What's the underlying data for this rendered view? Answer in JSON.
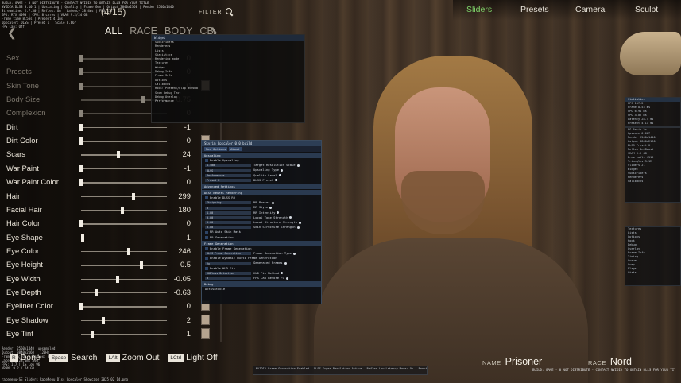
{
  "debug": {
    "top_lines": [
      "BUILD: GAME - 0 NOT DISTRIBUTE - CONTACT NVIDIA TO OBTAIN DLLS FOR YOUR TITLE",
      "NVIDIA DLSS 3.10.1 | Upscaling | Quality | Frame Gen | Output 3840x2160 | Render 2560x1440",
      "Streamline: 2.7.30 | Reflex: On | Latency 28.4ms | FPS 117",
      "GPU: RTX 4090 | CPU: 8 cores | VRAM 9.2/24 GB",
      "",
      "Frame time 8.5ms | Present 4.1ms",
      "Upscaler: DLSS | Preset K | Scale 0.667",
      "FPS Cap: Off"
    ],
    "bottom_lines": [
      "Render: 2560x1440 (upsampled)",
      "Output: 3840x2160 | 120Hz",
      "Frame Gen: On | Reflex: Boost",
      "Latency: 28.4ms avg",
      "FPS: 117 | 1% low 96",
      "VRAM: 9.2 / 24 GB"
    ],
    "filename": "racemenu-SE_Sliders_RaceMenu_Dlss_Upscaler_Showcase_2025_02_14.png",
    "right_footer": "BUILD: GAME - 0 NOT DISTRIBUTE - CONTACT NVIDIA TO OBTAIN DLLS FOR YOUR TITLE"
  },
  "header": {
    "count": "(4/15)",
    "filter_label": "FILTER",
    "filter_icon": "search-icon"
  },
  "categories": {
    "prev_icon": "chevron-left-icon",
    "next_icon": "chevron-right-icon",
    "items": [
      "ALL",
      "RACE",
      "BODY",
      "CB"
    ],
    "active": "ALL"
  },
  "sliders": [
    {
      "label": "Sex",
      "value": "0",
      "pos": 0.0,
      "swatch": false,
      "dim": true
    },
    {
      "label": "Presets",
      "value": "0",
      "pos": 0.0,
      "swatch": false,
      "dim": true
    },
    {
      "label": "Skin Tone",
      "value": "0",
      "pos": 0.0,
      "swatch": true,
      "dim": true
    },
    {
      "label": "Body Size",
      "value": "0.75",
      "pos": 0.75,
      "swatch": false,
      "dim": true
    },
    {
      "label": "Complexion",
      "value": "0",
      "pos": 0.0,
      "swatch": false,
      "dim": true
    },
    {
      "label": "Dirt",
      "value": "-1",
      "pos": 0.0,
      "swatch": false,
      "dim": false
    },
    {
      "label": "Dirt Color",
      "value": "0",
      "pos": 0.0,
      "swatch": true,
      "dim": false
    },
    {
      "label": "Scars",
      "value": "24",
      "pos": 0.45,
      "swatch": false,
      "dim": false
    },
    {
      "label": "War Paint",
      "value": "-1",
      "pos": 0.0,
      "swatch": false,
      "dim": false
    },
    {
      "label": "War Paint Color",
      "value": "0",
      "pos": 0.0,
      "swatch": true,
      "dim": false
    },
    {
      "label": "Hair",
      "value": "299",
      "pos": 0.63,
      "swatch": false,
      "dim": false
    },
    {
      "label": "Facial Hair",
      "value": "180",
      "pos": 0.5,
      "swatch": false,
      "dim": false
    },
    {
      "label": "Hair Color",
      "value": "0",
      "pos": 0.0,
      "swatch": true,
      "dim": false
    },
    {
      "label": "Eye Shape",
      "value": "1",
      "pos": 0.02,
      "swatch": false,
      "dim": false
    },
    {
      "label": "Eye Color",
      "value": "246",
      "pos": 0.58,
      "swatch": false,
      "dim": false
    },
    {
      "label": "Eye Height",
      "value": "0.5",
      "pos": 0.73,
      "swatch": false,
      "dim": false
    },
    {
      "label": "Eye Width",
      "value": "-0.05",
      "pos": 0.44,
      "swatch": false,
      "dim": false
    },
    {
      "label": "Eye Depth",
      "value": "-0.63",
      "pos": 0.18,
      "swatch": false,
      "dim": false
    },
    {
      "label": "Eyeliner Color",
      "value": "0",
      "pos": 0.0,
      "swatch": true,
      "dim": false
    },
    {
      "label": "Eye Shadow",
      "value": "2",
      "pos": 0.27,
      "swatch": true,
      "dim": false
    },
    {
      "label": "Eye Tint",
      "value": "1",
      "pos": 0.13,
      "swatch": true,
      "dim": false
    }
  ],
  "controls": [
    {
      "key": "R",
      "label": "Done"
    },
    {
      "key": "Space",
      "label": "Search"
    },
    {
      "key": "LAlt",
      "label": "Zoom Out"
    },
    {
      "key": "LCtrl",
      "label": "Light Off"
    }
  ],
  "tabs": [
    {
      "label": "Sliders",
      "active": true
    },
    {
      "label": "Presets",
      "active": false
    },
    {
      "label": "Camera",
      "active": false
    },
    {
      "label": "Sculpt",
      "active": false
    }
  ],
  "character": {
    "name_caption": "NAME",
    "name": "Prisoner",
    "race_caption": "RACE",
    "race": "Nord"
  },
  "widget_panel": {
    "title": "Widget",
    "lines": [
      "Subscribers",
      "Renderers",
      "Lists",
      "Statistics",
      "Rendering mode",
      "Textures",
      "Widget",
      "Debug Info",
      "Frame Info",
      "Options",
      "Callbacks",
      "Hook: Present/Flip #c0000",
      "Show Debug Text",
      "Debug Overlay",
      "Performance"
    ]
  },
  "upscaler": {
    "title": "Skyrim Upscaler 0.0 build",
    "menu": [
      "Mod Options",
      "About"
    ],
    "sections": [
      {
        "title": "Upscaling",
        "items": [
          {
            "type": "check",
            "label": "Enable Upscaling"
          },
          {
            "type": "field",
            "value": "1.500",
            "label": "Target Resolution Scale"
          },
          {
            "type": "field",
            "value": "DLSS",
            "label": "Upscaling Type"
          },
          {
            "type": "field",
            "value": "Performance",
            "label": "Quality Level"
          },
          {
            "type": "field",
            "value": "Preset K",
            "label": "DLSS Preset"
          }
        ]
      },
      {
        "title": "Advanced Settings",
        "items": []
      },
      {
        "title": "DLSS Neural Rendering",
        "items": [
          {
            "type": "check",
            "label": "Enable DLSS RR"
          },
          {
            "type": "field",
            "value": "Stripping",
            "label": "RR Preset"
          },
          {
            "type": "field",
            "value": "0",
            "label": "RR Style"
          },
          {
            "type": "field",
            "value": "1.00",
            "label": "RR Intensity"
          },
          {
            "type": "field",
            "value": "0.00",
            "label": "Local Tone Strength"
          },
          {
            "type": "field",
            "value": "0.00",
            "label": "Local Structure Strength"
          },
          {
            "type": "field",
            "value": "0.00",
            "label": "Skin Structure Strength"
          },
          {
            "type": "check",
            "label": "RR Auto Skin Mask"
          },
          {
            "type": "check",
            "label": "RR Generation"
          }
        ]
      },
      {
        "title": "Frame Generation",
        "items": [
          {
            "type": "check",
            "label": "Enable Frame Generation"
          },
          {
            "type": "field",
            "value": "DLSS Frame Generation",
            "label": "Frame Generation Type"
          },
          {
            "type": "check",
            "label": "Enable Dynamic Multi Frame Generation"
          },
          {
            "type": "field",
            "value": "2x",
            "label": "Generated Frames"
          },
          {
            "type": "check",
            "label": "Enable HUD Fix"
          },
          {
            "type": "field",
            "value": "HUDless Detection",
            "label": "HUD Fix Method"
          },
          {
            "type": "field",
            "value": "0",
            "label": "FPS Cap Before FG"
          }
        ]
      },
      {
        "title": "Debug",
        "items": [
          {
            "type": "text",
            "label": "Activatable"
          }
        ]
      }
    ]
  },
  "right_panels": {
    "top_title": "Statistics",
    "top_lines": [
      "FPS 117.2",
      "Frame 8.53 ms",
      "GPU 6.91 ms",
      "CPU 4.02 ms",
      "Latency 28.4 ms",
      "Present 4.11 ms",
      "FG Ratio 2x",
      "Upscale 0.667",
      "Render 2560x1440",
      "Output 3840x2160",
      "DLSS Preset K",
      "Reflex On+Boost",
      "VRAM 9.2 GB",
      "Draw calls 4512",
      "Triangles 3.1M",
      "Sliders 21",
      "Widget",
      "Subscribers",
      "Renderers",
      "Callbacks"
    ],
    "mid_lines": [
      "Textures",
      "Lists",
      "Options",
      "Hook",
      "Debug",
      "Overlay",
      "Frame Info",
      "Timing",
      "Queue",
      "Swap",
      "Flags",
      "Stats"
    ],
    "log": [
      "NVIDIA Frame Generation Enabled",
      "DLSS Super Resolution Active",
      "Reflex Low Latency Mode: On + Boost"
    ]
  }
}
